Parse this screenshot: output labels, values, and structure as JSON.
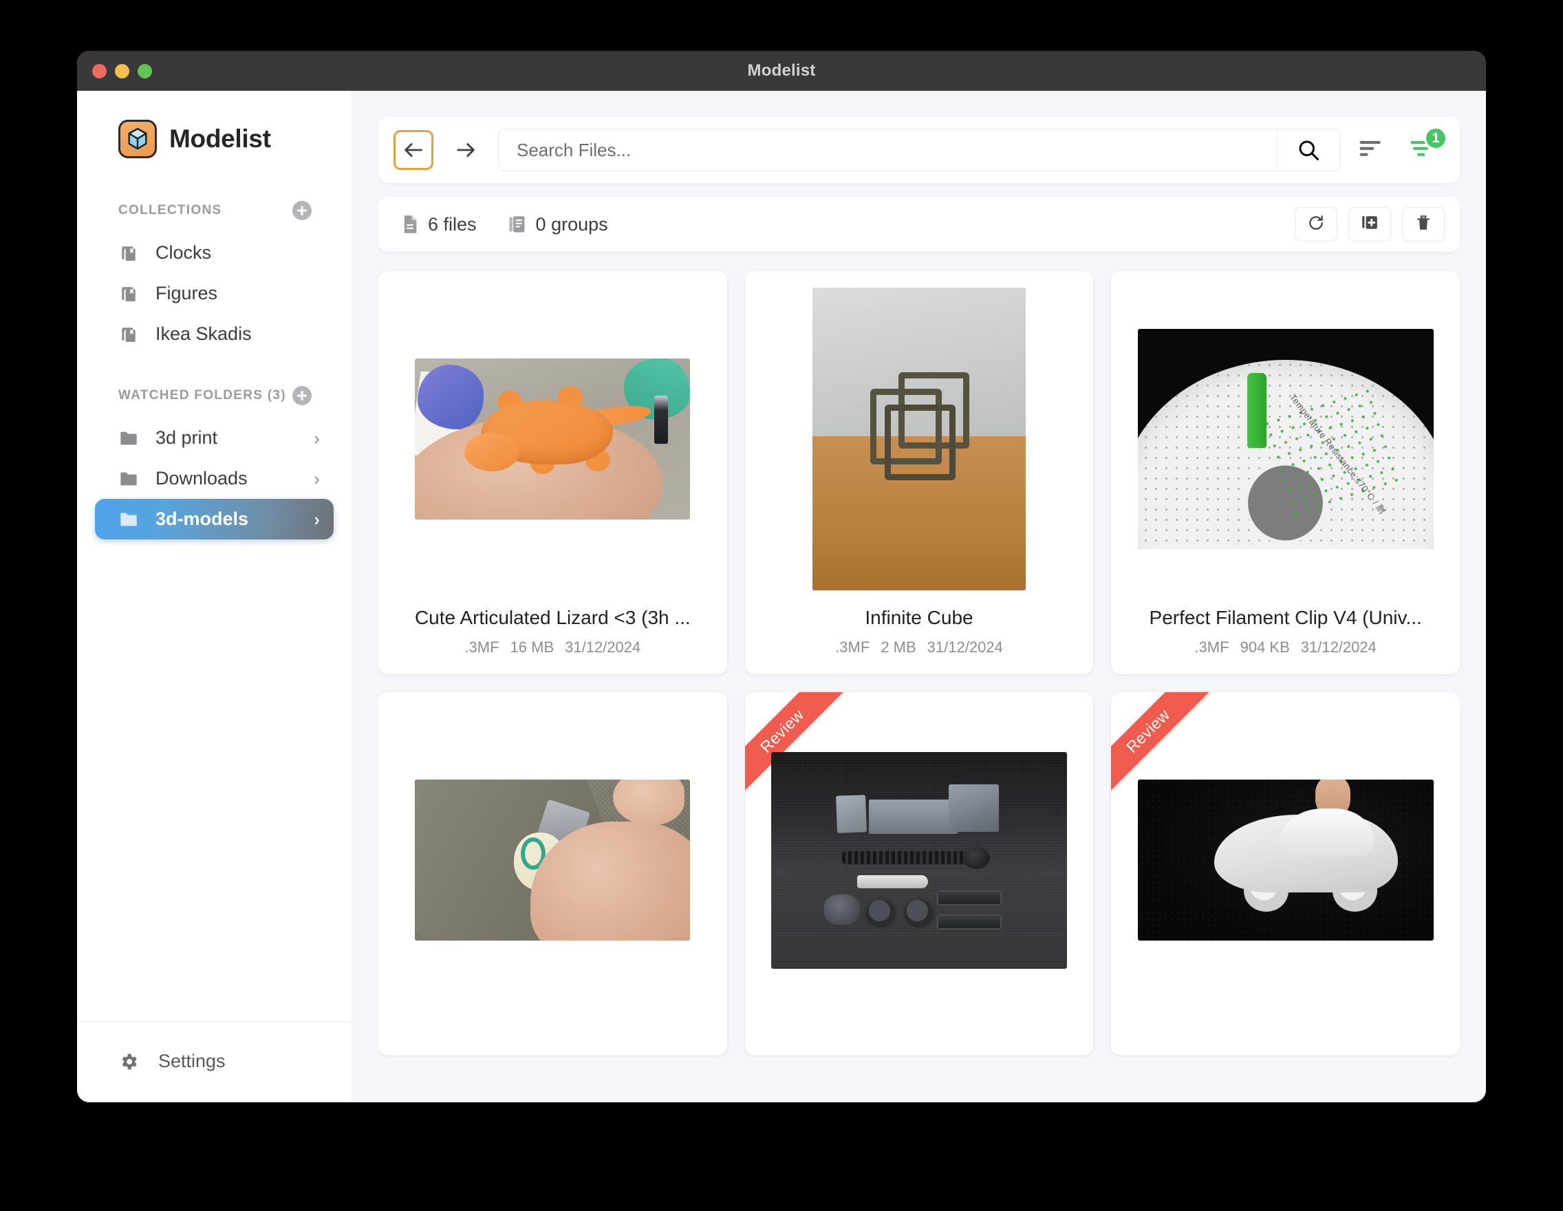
{
  "window": {
    "title": "Modelist",
    "traffic_lights": [
      "close",
      "minimize",
      "zoom"
    ]
  },
  "sidebar": {
    "brand": {
      "name": "Modelist",
      "logo_icon": "cube-logo-icon"
    },
    "collections": {
      "header": "COLLECTIONS",
      "add_label": "+",
      "items": [
        {
          "label": "Clocks",
          "icon": "collection-icon"
        },
        {
          "label": "Figures",
          "icon": "collection-icon"
        },
        {
          "label": "Ikea Skadis",
          "icon": "collection-icon"
        }
      ]
    },
    "watched_folders": {
      "header": "WATCHED FOLDERS (3)",
      "add_label": "+",
      "items": [
        {
          "label": "3d print",
          "icon": "folder-icon",
          "chevron": "›",
          "selected": false
        },
        {
          "label": "Downloads",
          "icon": "folder-icon",
          "chevron": "›",
          "selected": false
        },
        {
          "label": "3d-models",
          "icon": "folder-icon",
          "chevron": "›",
          "selected": true
        }
      ]
    },
    "settings": {
      "label": "Settings",
      "icon": "gear-icon"
    },
    "selected_color": "#4ea3e8"
  },
  "toolbar": {
    "back_icon": "arrow-left-icon",
    "forward_icon": "arrow-right-icon",
    "back_focused": true,
    "focus_ring_color": "#e4a13c",
    "search": {
      "placeholder": "Search Files...",
      "value": ""
    },
    "search_button_icon": "search-icon",
    "sort_icon": "sort-icon",
    "filter_icon": "filter-icon",
    "filter_badge": "1",
    "filter_badge_color": "#49c463",
    "filter_active_color": "#49c463"
  },
  "statusbar": {
    "files_count": "6 files",
    "files_icon": "file-icon",
    "groups_count": "0 groups",
    "groups_icon": "group-icon",
    "actions": [
      {
        "name": "refresh",
        "icon": "refresh-icon"
      },
      {
        "name": "add-to-collection",
        "icon": "add-to-collection-icon"
      },
      {
        "name": "delete",
        "icon": "trash-icon"
      }
    ]
  },
  "grid": {
    "cards": [
      {
        "title": "Cute Articulated Lizard <3 (3h ...",
        "format": ".3MF",
        "size": "16 MB",
        "date": "31/12/2024",
        "ribbon": null,
        "thumb": "lizard-in-hand-photo",
        "thumb_w": 400,
        "thumb_h": 234
      },
      {
        "title": "Infinite Cube",
        "format": ".3MF",
        "size": "2 MB",
        "date": "31/12/2024",
        "ribbon": null,
        "thumb": "infinite-cube-photo",
        "thumb_w": 340,
        "thumb_h": 450
      },
      {
        "title": "Perfect Filament Clip V4 (Univ...",
        "format": ".3MF",
        "size": "904 KB",
        "date": "31/12/2024",
        "ribbon": null,
        "thumb": "filament-clip-photo",
        "thumb_w": 430,
        "thumb_h": 320,
        "overlay_text": "Temperature Resistance:≤70°C / 耐"
      },
      {
        "title": "",
        "format": "",
        "size": "",
        "date": "",
        "ribbon": null,
        "thumb": "tape-dispenser-photo",
        "thumb_w": 400,
        "thumb_h": 234
      },
      {
        "title": "",
        "format": "",
        "size": "",
        "date": "",
        "ribbon": "Review",
        "ribbon_color": "#ef5b4c",
        "thumb": "vise-parts-photo",
        "thumb_w": 430,
        "thumb_h": 315
      },
      {
        "title": "",
        "format": "",
        "size": "",
        "date": "",
        "ribbon": "Review",
        "ribbon_color": "#ef5b4c",
        "thumb": "toy-car-photo",
        "thumb_w": 430,
        "thumb_h": 234
      }
    ]
  }
}
